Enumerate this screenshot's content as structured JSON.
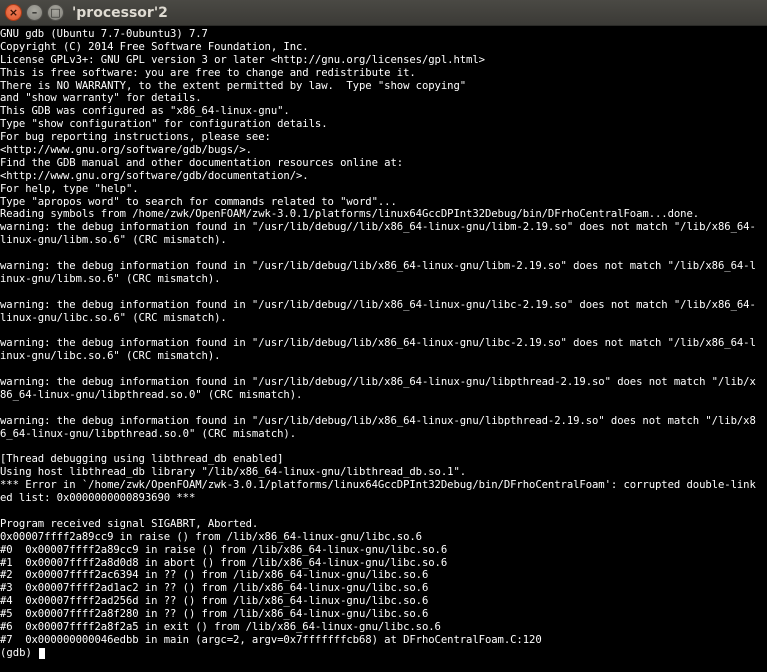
{
  "window": {
    "title": "'processor'2",
    "close_glyph": "×",
    "minimize_glyph": "–",
    "maximize_glyph": "□"
  },
  "terminal": {
    "lines": [
      "GNU gdb (Ubuntu 7.7-0ubuntu3) 7.7",
      "Copyright (C) 2014 Free Software Foundation, Inc.",
      "License GPLv3+: GNU GPL version 3 or later <http://gnu.org/licenses/gpl.html>",
      "This is free software: you are free to change and redistribute it.",
      "There is NO WARRANTY, to the extent permitted by law.  Type \"show copying\"",
      "and \"show warranty\" for details.",
      "This GDB was configured as \"x86_64-linux-gnu\".",
      "Type \"show configuration\" for configuration details.",
      "For bug reporting instructions, please see:",
      "<http://www.gnu.org/software/gdb/bugs/>.",
      "Find the GDB manual and other documentation resources online at:",
      "<http://www.gnu.org/software/gdb/documentation/>.",
      "For help, type \"help\".",
      "Type \"apropos word\" to search for commands related to \"word\"...",
      "Reading symbols from /home/zwk/OpenFOAM/zwk-3.0.1/platforms/linux64GccDPInt32Debug/bin/DFrhoCentralFoam...done.",
      "warning: the debug information found in \"/usr/lib/debug//lib/x86_64-linux-gnu/libm-2.19.so\" does not match \"/lib/x86_64-",
      "linux-gnu/libm.so.6\" (CRC mismatch).",
      "",
      "warning: the debug information found in \"/usr/lib/debug/lib/x86_64-linux-gnu/libm-2.19.so\" does not match \"/lib/x86_64-l",
      "inux-gnu/libm.so.6\" (CRC mismatch).",
      "",
      "warning: the debug information found in \"/usr/lib/debug//lib/x86_64-linux-gnu/libc-2.19.so\" does not match \"/lib/x86_64-",
      "linux-gnu/libc.so.6\" (CRC mismatch).",
      "",
      "warning: the debug information found in \"/usr/lib/debug/lib/x86_64-linux-gnu/libc-2.19.so\" does not match \"/lib/x86_64-l",
      "inux-gnu/libc.so.6\" (CRC mismatch).",
      "",
      "warning: the debug information found in \"/usr/lib/debug//lib/x86_64-linux-gnu/libpthread-2.19.so\" does not match \"/lib/x",
      "86_64-linux-gnu/libpthread.so.0\" (CRC mismatch).",
      "",
      "warning: the debug information found in \"/usr/lib/debug/lib/x86_64-linux-gnu/libpthread-2.19.so\" does not match \"/lib/x8",
      "6_64-linux-gnu/libpthread.so.0\" (CRC mismatch).",
      "",
      "[Thread debugging using libthread_db enabled]",
      "Using host libthread_db library \"/lib/x86_64-linux-gnu/libthread_db.so.1\".",
      "*** Error in `/home/zwk/OpenFOAM/zwk-3.0.1/platforms/linux64GccDPInt32Debug/bin/DFrhoCentralFoam': corrupted double-link",
      "ed list: 0x0000000000893690 ***",
      "",
      "Program received signal SIGABRT, Aborted.",
      "0x00007ffff2a89cc9 in raise () from /lib/x86_64-linux-gnu/libc.so.6",
      "#0  0x00007ffff2a89cc9 in raise () from /lib/x86_64-linux-gnu/libc.so.6",
      "#1  0x00007ffff2a8d0d8 in abort () from /lib/x86_64-linux-gnu/libc.so.6",
      "#2  0x00007ffff2ac6394 in ?? () from /lib/x86_64-linux-gnu/libc.so.6",
      "#3  0x00007ffff2ad1ac2 in ?? () from /lib/x86_64-linux-gnu/libc.so.6",
      "#4  0x00007ffff2ad256d in ?? () from /lib/x86_64-linux-gnu/libc.so.6",
      "#5  0x00007ffff2a8f280 in ?? () from /lib/x86_64-linux-gnu/libc.so.6",
      "#6  0x00007ffff2a8f2a5 in exit () from /lib/x86_64-linux-gnu/libc.so.6",
      "#7  0x000000000046edbb in main (argc=2, argv=0x7fffffffcb68) at DFrhoCentralFoam.C:120"
    ],
    "prompt": "(gdb) "
  }
}
